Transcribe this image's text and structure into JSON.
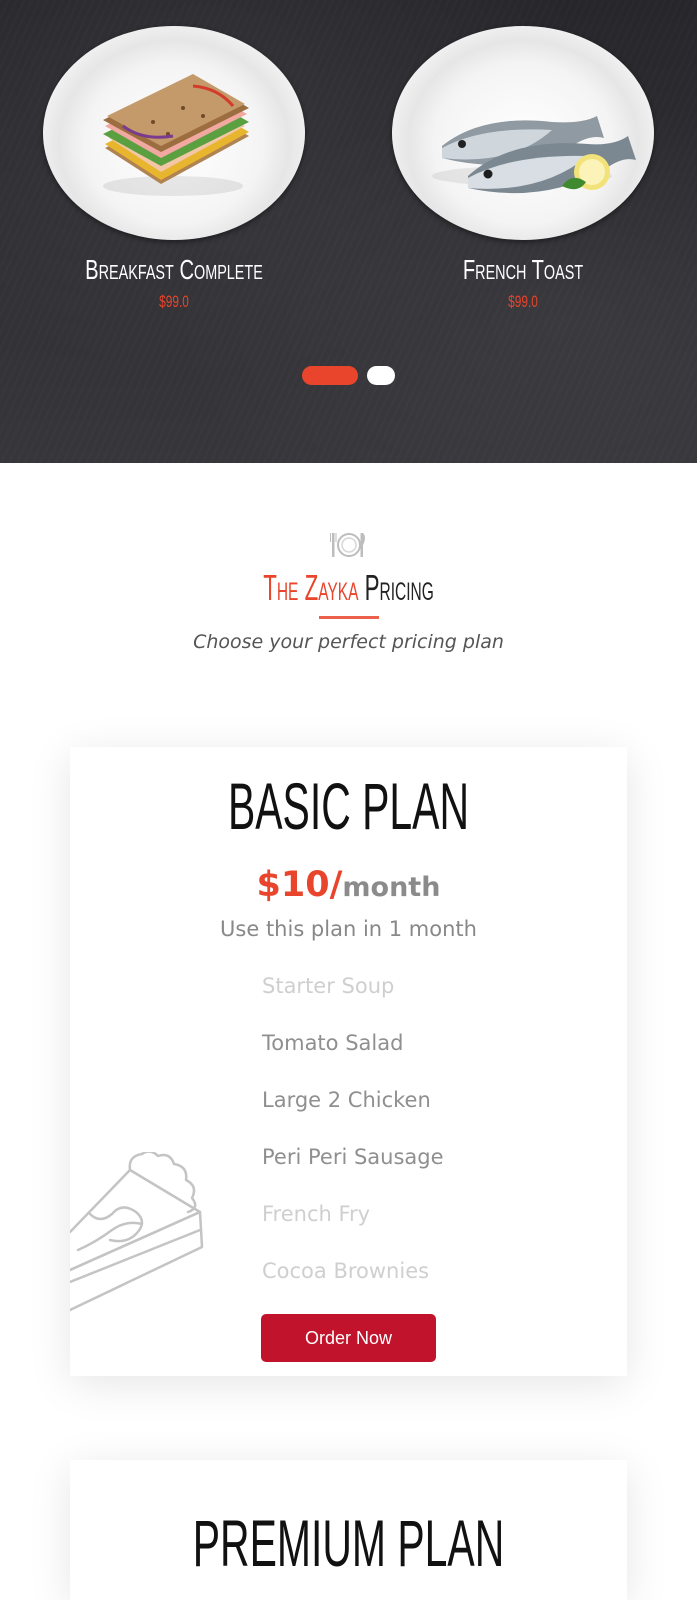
{
  "carousel": {
    "slides": [
      {
        "name": "Breakfast Complete",
        "price": "$99.0",
        "image_icon": "sandwich-plate-icon"
      },
      {
        "name": "French Toast",
        "price": "$99.0",
        "image_icon": "fish-plate-icon"
      }
    ],
    "active_index": 0,
    "pager_count": 2
  },
  "section": {
    "icon": "cutlery-plate-icon",
    "title_accent": "The Zayka",
    "title_plain": "Pricing",
    "subtitle": "Choose your perfect pricing plan"
  },
  "plans": [
    {
      "name": "BASIC PLAN",
      "amount": "$10/",
      "period": "month",
      "duration": "Use this plan in 1 month",
      "features": [
        "Starter Soup",
        "Tomato Salad",
        "Large 2 Chicken",
        "Peri Peri Sausage",
        "French Fry",
        "Cocoa Brownies"
      ],
      "order_label": "Order Now",
      "decoration_icon": "cake-slice-icon"
    },
    {
      "name": "PREMIUM PLAN"
    }
  ],
  "colors": {
    "accent": "#e8452c",
    "button": "#c1132b",
    "hero_bg": "#2e2e33"
  }
}
